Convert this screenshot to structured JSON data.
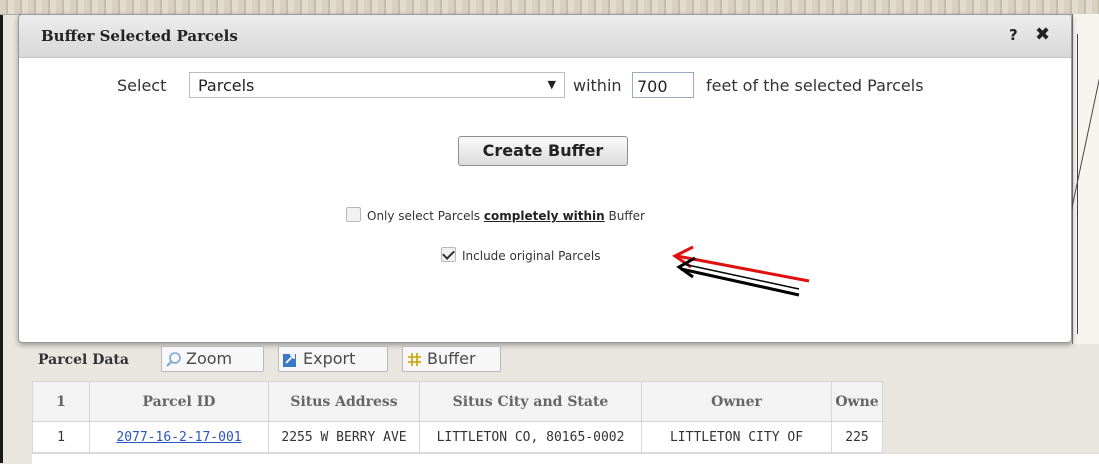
{
  "dialog": {
    "title": "Buffer Selected Parcels",
    "help_label": "?",
    "close_label": "✖",
    "select_label": "Select",
    "layer_select_value": "Parcels",
    "within_label": "within",
    "distance_value": "700",
    "feet_label": "feet of the selected Parcels",
    "create_button_label": "Create Buffer",
    "only_select_prefix": "Only select Parcels",
    "only_select_emphasis": "completely within",
    "only_select_suffix": "Buffer",
    "only_select_checked": false,
    "include_original_label": "Include original Parcels",
    "include_original_checked": true
  },
  "annotation_colors": {
    "red_arrow": "#e01010",
    "black_arrow": "#000000"
  },
  "panel": {
    "title": "Parcel Data",
    "zoom_label": "Zoom",
    "export_label": "Export",
    "buffer_label": "Buffer"
  },
  "table": {
    "headers": [
      "1",
      "Parcel ID",
      "Situs Address",
      "Situs City and State",
      "Owner",
      "Owne"
    ],
    "rows": [
      [
        "1",
        "2077-16-2-17-001",
        "2255 W BERRY AVE",
        "LITTLETON CO, 80165-0002",
        "LITTLETON CITY OF",
        "225"
      ]
    ]
  }
}
